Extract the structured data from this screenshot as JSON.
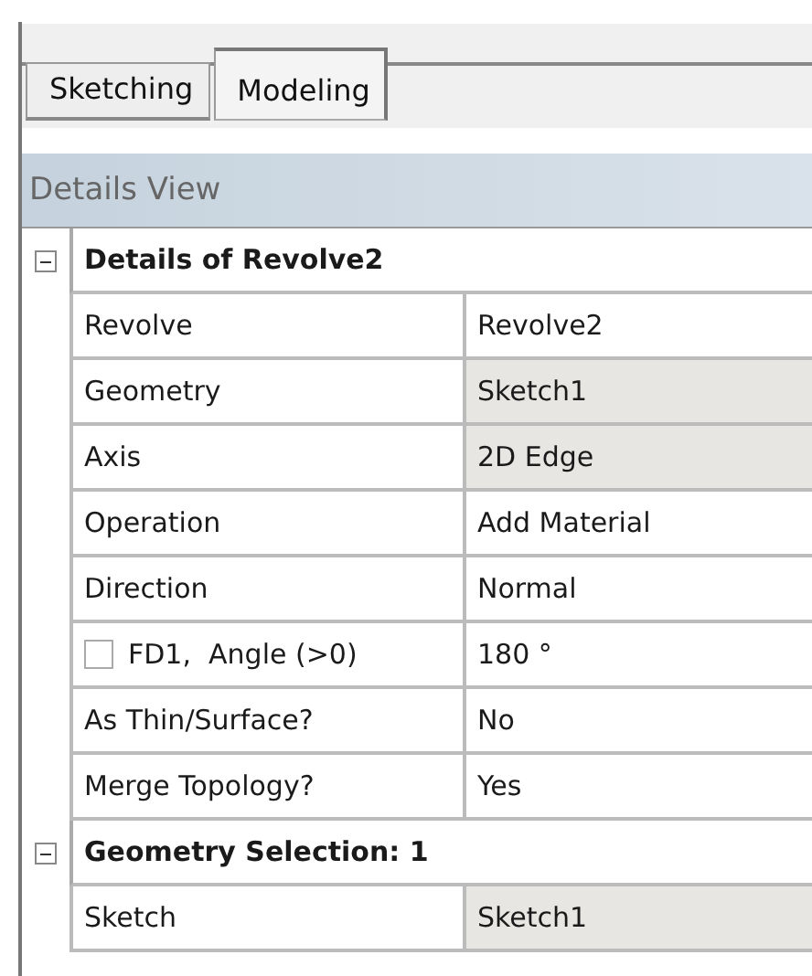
{
  "tabs": [
    {
      "label": "Sketching",
      "selected": false
    },
    {
      "label": "Modeling",
      "selected": true
    }
  ],
  "details_view": {
    "title": "Details View",
    "groups": [
      {
        "title": "Details of Revolve2",
        "expanded": true,
        "rows": [
          {
            "label": "Revolve",
            "value": "Revolve2",
            "shaded": false
          },
          {
            "label": "Geometry",
            "value": "Sketch1",
            "shaded": true
          },
          {
            "label": "Axis",
            "value": "2D Edge",
            "shaded": true
          },
          {
            "label": "Operation",
            "value": "Add Material",
            "shaded": false
          },
          {
            "label": "Direction",
            "value": "Normal",
            "shaded": false
          },
          {
            "label": "FD1,  Angle (>0)",
            "value": "180 °",
            "shaded": false,
            "checkbox": {
              "checked": false
            }
          },
          {
            "label": "As Thin/Surface?",
            "value": "No",
            "shaded": false
          },
          {
            "label": "Merge Topology?",
            "value": "Yes",
            "shaded": false
          }
        ]
      },
      {
        "title": "Geometry Selection: 1",
        "expanded": true,
        "rows": [
          {
            "label": "Sketch",
            "value": "Sketch1",
            "shaded": true
          }
        ]
      }
    ]
  }
}
